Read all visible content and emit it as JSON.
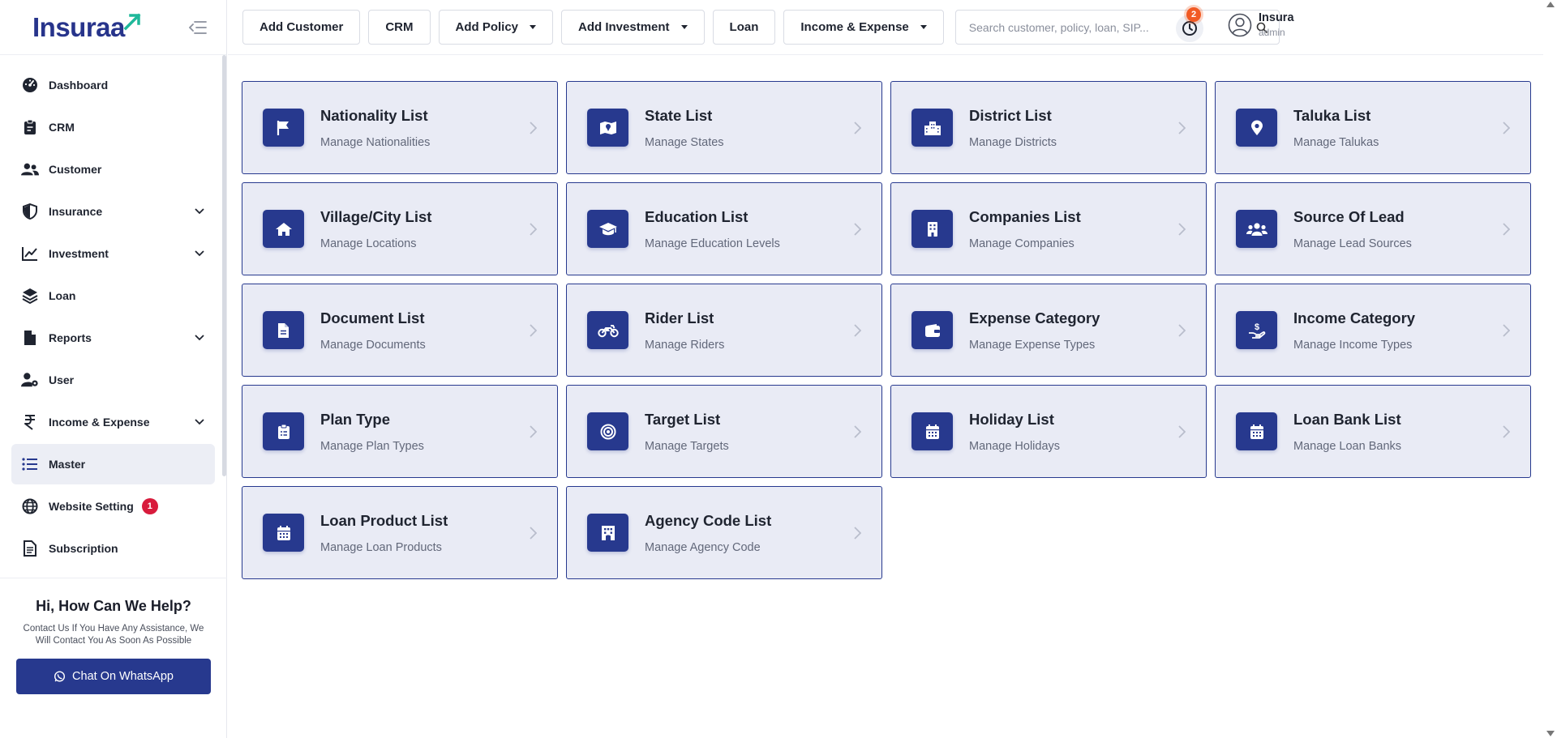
{
  "app": {
    "logo_text": "Insuraa"
  },
  "colors": {
    "primary": "#27398e",
    "card_bg": "#e9ebf5",
    "badge_red": "#d81b3c",
    "badge_orange": "#f15a24",
    "logo_green": "#1fb89a"
  },
  "sidebar": {
    "items": [
      {
        "label": "Dashboard",
        "icon": "dashboard-gauge-icon",
        "chevron": false
      },
      {
        "label": "CRM",
        "icon": "clipboard-icon",
        "chevron": false
      },
      {
        "label": "Customer",
        "icon": "users-icon",
        "chevron": false
      },
      {
        "label": "Insurance",
        "icon": "shield-icon",
        "chevron": true
      },
      {
        "label": "Investment",
        "icon": "line-chart-icon",
        "chevron": true
      },
      {
        "label": "Loan",
        "icon": "layers-icon",
        "chevron": false
      },
      {
        "label": "Reports",
        "icon": "file-icon",
        "chevron": true
      },
      {
        "label": "User",
        "icon": "user-gear-icon",
        "chevron": false
      },
      {
        "label": "Income & Expense",
        "icon": "rupee-icon",
        "chevron": true
      },
      {
        "label": "Master",
        "icon": "list-icon",
        "chevron": false,
        "active": true
      },
      {
        "label": "Website Setting",
        "icon": "globe-icon",
        "chevron": false,
        "badge": "1"
      },
      {
        "label": "Subscription",
        "icon": "document-icon",
        "chevron": false
      }
    ]
  },
  "help": {
    "title": "Hi, How Can We Help?",
    "text": "Contact Us If You Have Any Assistance, We Will Contact You As Soon As Possible",
    "button_label": "Chat On WhatsApp"
  },
  "topbar": {
    "buttons": [
      {
        "label": "Add Customer",
        "dropdown": false
      },
      {
        "label": "CRM",
        "dropdown": false
      },
      {
        "label": "Add Policy",
        "dropdown": true
      },
      {
        "label": "Add Investment",
        "dropdown": true
      },
      {
        "label": "Loan",
        "dropdown": false
      },
      {
        "label": "Income & Expense",
        "dropdown": true
      }
    ],
    "search_placeholder": "Search customer, policy, loan, SIP...",
    "search_value": "",
    "notification_count": "2",
    "user_name": "Insura",
    "user_role": "admin"
  },
  "cards": [
    {
      "title": "Nationality List",
      "subtitle": "Manage Nationalities",
      "icon": "flag-icon"
    },
    {
      "title": "State List",
      "subtitle": "Manage States",
      "icon": "map-icon"
    },
    {
      "title": "District List",
      "subtitle": "Manage Districts",
      "icon": "city-icon"
    },
    {
      "title": "Taluka List",
      "subtitle": "Manage Talukas",
      "icon": "map-pin-icon"
    },
    {
      "title": "Village/City List",
      "subtitle": "Manage Locations",
      "icon": "home-icon"
    },
    {
      "title": "Education List",
      "subtitle": "Manage Education Levels",
      "icon": "graduation-cap-icon"
    },
    {
      "title": "Companies List",
      "subtitle": "Manage Companies",
      "icon": "building-icon"
    },
    {
      "title": "Source Of Lead",
      "subtitle": "Manage Lead Sources",
      "icon": "people-group-icon"
    },
    {
      "title": "Document List",
      "subtitle": "Manage Documents",
      "icon": "file-lines-icon"
    },
    {
      "title": "Rider List",
      "subtitle": "Manage Riders",
      "icon": "motorcycle-icon"
    },
    {
      "title": "Expense Category",
      "subtitle": "Manage Expense Types",
      "icon": "wallet-icon"
    },
    {
      "title": "Income Category",
      "subtitle": "Manage Income Types",
      "icon": "hand-money-icon"
    },
    {
      "title": "Plan Type",
      "subtitle": "Manage Plan Types",
      "icon": "clipboard-list-icon"
    },
    {
      "title": "Target List",
      "subtitle": "Manage Targets",
      "icon": "target-icon"
    },
    {
      "title": "Holiday List",
      "subtitle": "Manage Holidays",
      "icon": "calendar-icon"
    },
    {
      "title": "Loan Bank List",
      "subtitle": "Manage Loan Banks",
      "icon": "calendar-icon"
    },
    {
      "title": "Loan Product List",
      "subtitle": "Manage Loan Products",
      "icon": "calendar-icon"
    },
    {
      "title": "Agency Code List",
      "subtitle": "Manage Agency Code",
      "icon": "office-building-icon"
    }
  ]
}
